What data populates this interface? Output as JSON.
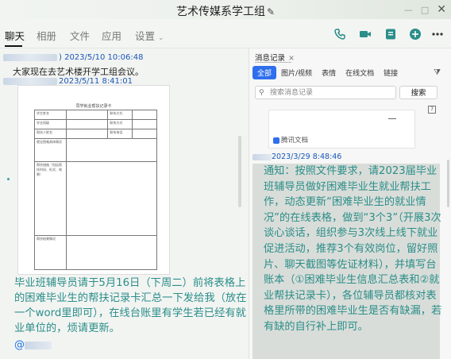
{
  "window": {
    "title": "艺术传媒系学工组",
    "title_icon": "pencil-icon"
  },
  "tabs": [
    "聊天",
    "相册",
    "文件",
    "应用",
    "设置"
  ],
  "toolbar_icons": [
    "phone-icon",
    "video-icon",
    "screen-share-icon",
    "add-icon",
    "more-icon"
  ],
  "chat": {
    "messages": [
      {
        "time": ") 2023/5/10 10:06:48",
        "text": "大家现在去艺术楼开学工组会议。"
      },
      {
        "time": "2023/5/11 8:41:01"
      }
    ],
    "doc_preview": {
      "title": "同学就业帮扶记录卡",
      "rows": [
        [
          "学生姓名",
          "",
          "联系方式",
          ""
        ],
        [
          "学业班级",
          "",
          "联系方式",
          ""
        ],
        [
          "帮扶人姓名",
          "",
          "联系电话",
          ""
        ],
        [
          "就业困难具体情况",
          "",
          "",
          ""
        ],
        [
          "帮扶措施（包括帮扶时间、形式、效果）",
          "",
          "",
          ""
        ],
        [
          "帮扶结果情况",
          "",
          "",
          ""
        ]
      ]
    },
    "big_message": "毕业班辅导员请于5月16日（下周二）前将表格上的困难毕业生的帮扶记录卡汇总一下发给我（放在一个word里即可），在线台账里有学生若已经有就业单位的，烦请更新。",
    "mention": "@"
  },
  "history_panel": {
    "tab_label": "消息记录",
    "filters": [
      "全部",
      "图片/视频",
      "表情",
      "在线文档",
      "链接"
    ],
    "search_placeholder": "搜索消息记录",
    "search_button": "搜索",
    "card_footer": "腾讯文档",
    "entry_time": "2023/3/29 8:48:46",
    "notice": "通知：按照文件要求，请2023届毕业班辅导员做好困难毕业生就业帮扶工作，动态更新“困难毕业生的就业情况”的在线表格，做到“3个3”（开展3次谈心谈话，组织参与3次线上线下就业促进活动，推荐3个有效岗位，留好照片、聊天截图等佐证材料），并填写台账本（①困难毕业生信息汇总表和②就业帮扶记录卡），各位辅导员都核对表格里所带的困难毕业生是否有缺漏，若有缺的自行补上即可。"
  },
  "colors": {
    "accent": "#2f6fed",
    "message_teal": "#2b8e89",
    "link_blue": "#1a56b8"
  }
}
